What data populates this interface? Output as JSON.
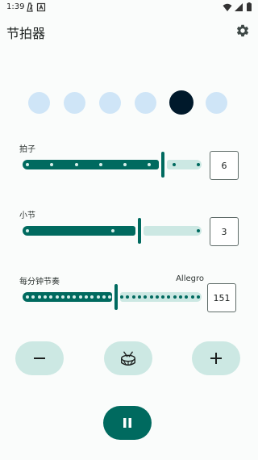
{
  "status_bar": {
    "time": "1:39"
  },
  "app_bar": {
    "title": "节拍器"
  },
  "beats": {
    "total": 6,
    "active_index": 4
  },
  "time_signature": {
    "label": "拍子",
    "value": "6",
    "min": 1,
    "max": 8,
    "fraction": 0.78
  },
  "measure": {
    "label": "小节",
    "value": "3",
    "min": 1,
    "max": 4,
    "fraction": 0.65
  },
  "bpm": {
    "label": "每分钟节奏",
    "tempo_name": "Allegro",
    "value": "151",
    "fraction": 0.52
  },
  "colors": {
    "primary": "#006a5f",
    "track_inactive": "#cce8e3",
    "beat_dot": "#cfe5f7",
    "beat_dot_active": "#00192b",
    "background": "#fafcfb"
  },
  "icons": {
    "settings": "gear-icon",
    "decrease": "minus-icon",
    "drum": "drum-icon",
    "increase": "plus-icon",
    "pause": "pause-icon"
  }
}
